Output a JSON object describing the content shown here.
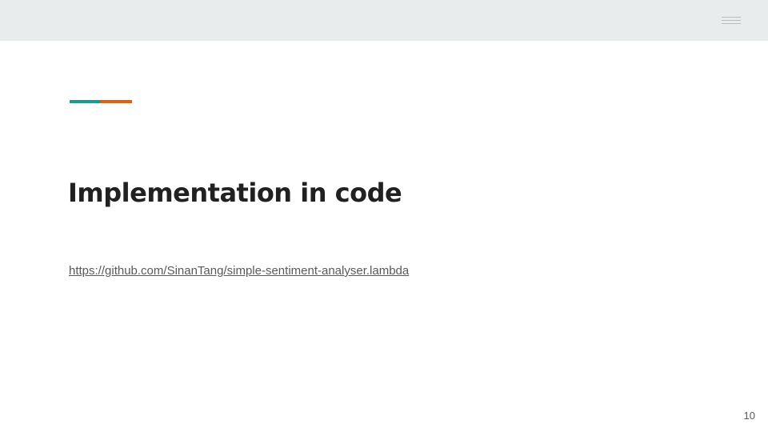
{
  "slide": {
    "title": "Implementation in code",
    "link_text": "https://github.com/SinanTang/simple-sentiment-analyser.lambda",
    "page_number": "10"
  },
  "header": {
    "menu_icon": "hamburger-menu-icon",
    "band_color": "#e8eced"
  },
  "accent_bar": {
    "colors": [
      "#1c9a8f",
      "#e0600f"
    ]
  }
}
